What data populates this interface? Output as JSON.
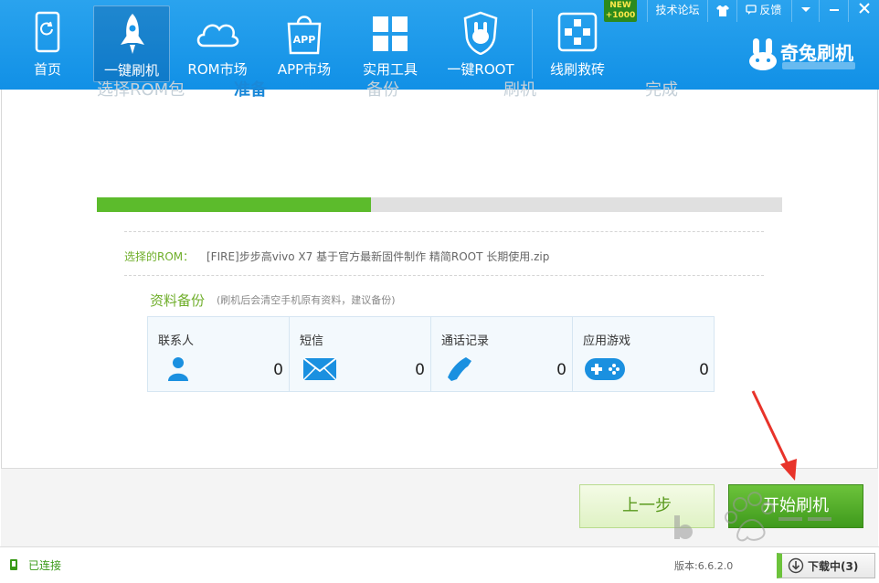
{
  "nav": {
    "items": [
      {
        "label": "首页",
        "icon": "home-phone-icon"
      },
      {
        "label": "一键刷机",
        "icon": "rocket-icon"
      },
      {
        "label": "ROM市场",
        "icon": "cloud-icon"
      },
      {
        "label": "APP市场",
        "icon": "app-bag-icon"
      },
      {
        "label": "实用工具",
        "icon": "windows-grid-icon"
      },
      {
        "label": "一键ROOT",
        "icon": "root-shield-icon"
      },
      {
        "label": "线刷救砖",
        "icon": "plus-cross-icon"
      }
    ],
    "active_index": 1,
    "new_badge": {
      "line1": "NEW",
      "line2": "+1000"
    }
  },
  "top_right": {
    "forum": "技术论坛",
    "feedback": "反馈"
  },
  "brand": {
    "name": "奇兔刷机"
  },
  "steps": {
    "labels": [
      "选择ROM包",
      "准备",
      "备份",
      "刷机",
      "完成"
    ],
    "active_index": 1,
    "progress_fraction": 0.4
  },
  "rom": {
    "label": "选择的ROM：",
    "value": "[FIRE]步步高vivo X7  基于官方最新固件制作 精简ROOT 长期使用.zip"
  },
  "backup": {
    "title": "资料备份",
    "note": "(刷机后会清空手机原有资料，建议备份)",
    "items": [
      {
        "label": "联系人",
        "count": "0",
        "icon": "contact-person-icon"
      },
      {
        "label": "短信",
        "count": "0",
        "icon": "envelope-icon"
      },
      {
        "label": "通话记录",
        "count": "0",
        "icon": "phone-handset-icon"
      },
      {
        "label": "应用游戏",
        "count": "0",
        "icon": "gamepad-icon"
      }
    ]
  },
  "buttons": {
    "prev": "上一步",
    "start": "开始刷机"
  },
  "status": {
    "connected": "已连接",
    "version": "版本:6.6.2.0",
    "downloads": "下载中(3)"
  },
  "colors": {
    "header": "#1a97ea",
    "accent_green": "#5cbb2c",
    "active_step": "#1a88d8",
    "arrow": "#e8332a"
  }
}
